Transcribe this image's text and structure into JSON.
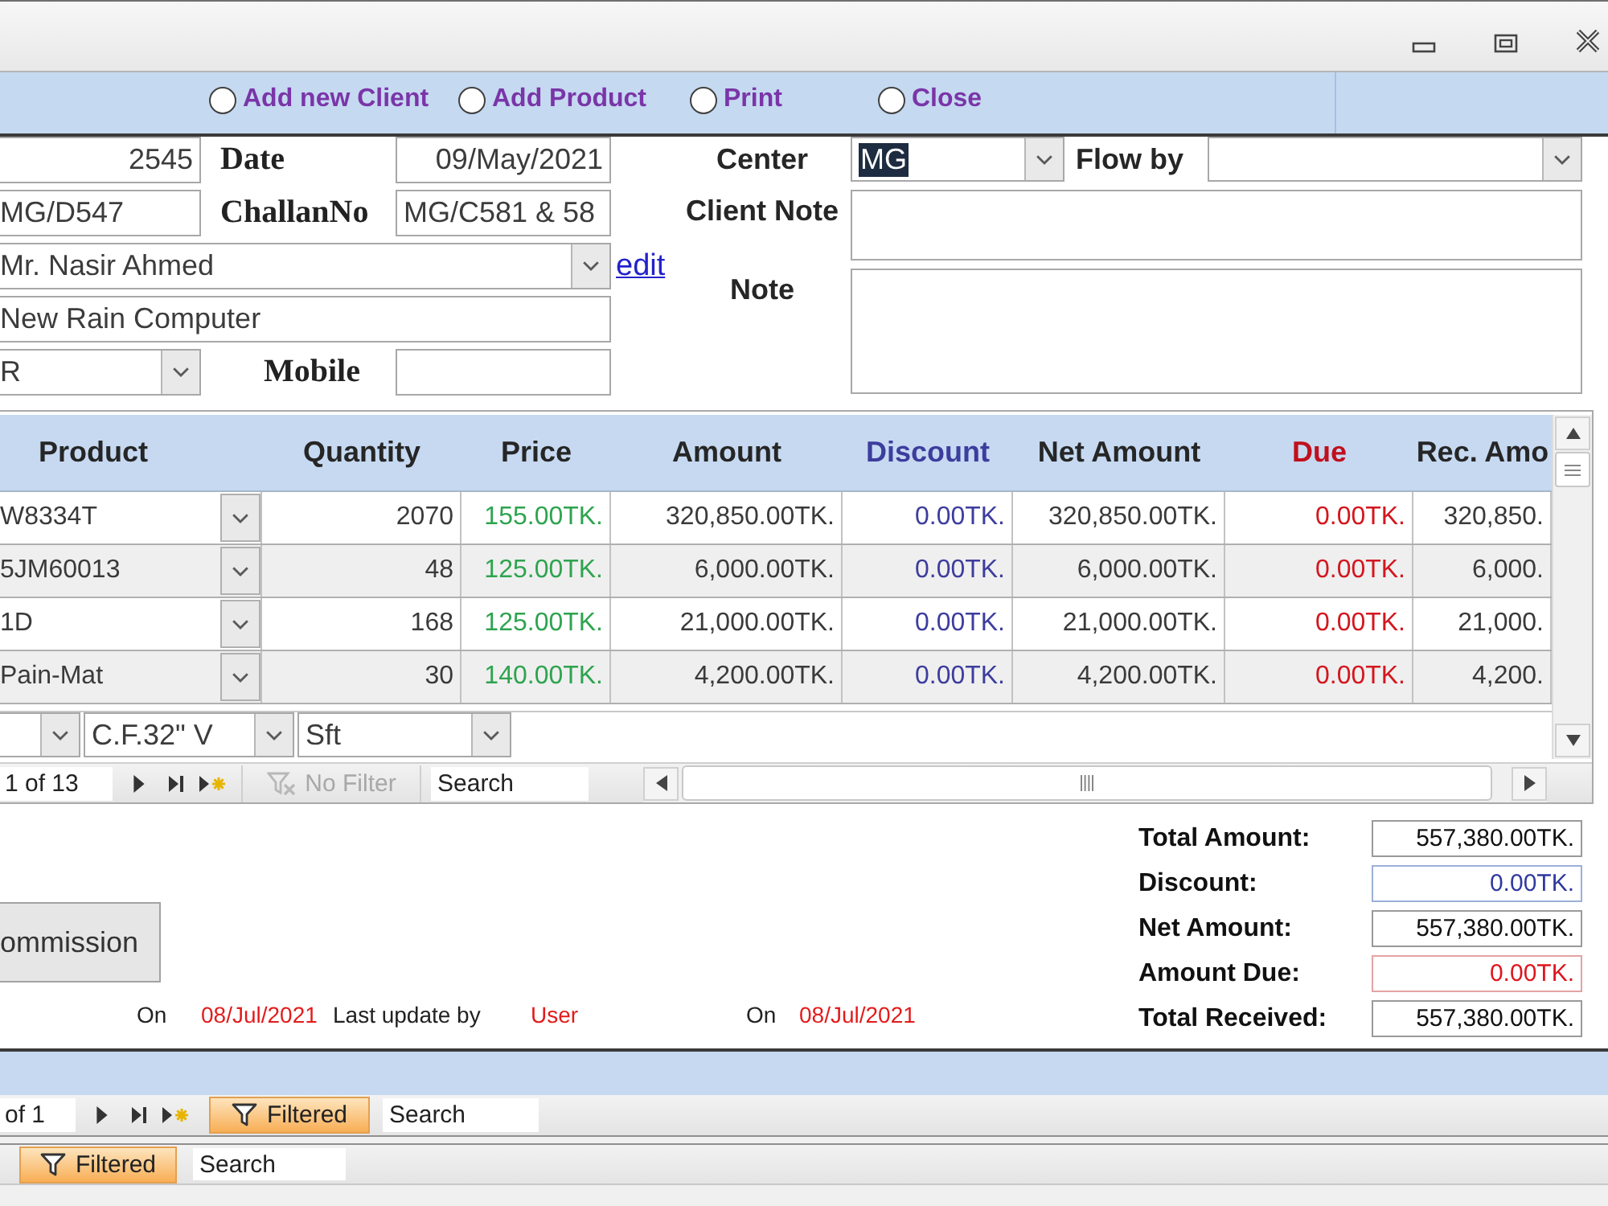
{
  "options": [
    {
      "label": "Add new Client",
      "selected": false
    },
    {
      "label": "Add Product",
      "selected": false
    },
    {
      "label": "Print",
      "selected": false
    },
    {
      "label": "Close",
      "selected": false
    }
  ],
  "form": {
    "field_1": {
      "value": "2545"
    },
    "date": {
      "label": "Date",
      "value": "09/May/2021"
    },
    "center": {
      "label": "Center",
      "value": "MG",
      "highlighted": true
    },
    "flow_by": {
      "label": "Flow by"
    },
    "field_2": {
      "value": "MG/D547"
    },
    "challan_no": {
      "label": "ChallanNo",
      "value": "MG/C581 & 58"
    },
    "client_note": {
      "label": "Client Note"
    },
    "field_3": {
      "value": "Mr. Nasir Ahmed"
    },
    "edit_link": "edit",
    "note": {
      "label": "Note"
    },
    "field_4": {
      "value": "New Rain Computer"
    },
    "field_5": {
      "value": "R"
    },
    "mobile": {
      "label": "Mobile"
    }
  },
  "grid": {
    "columns": [
      {
        "label": "Product",
        "kind": "combo"
      },
      {
        "label": "Quantity",
        "kind": "number"
      },
      {
        "label": "Price",
        "kind": "price"
      },
      {
        "label": "Amount",
        "kind": "number"
      },
      {
        "label": "Discount",
        "kind": "discount"
      },
      {
        "label": "Net Amount",
        "kind": "number"
      },
      {
        "label": "Due",
        "kind": "due"
      },
      {
        "label": "Rec. Amo",
        "kind": "number"
      }
    ],
    "rows": [
      [
        "W8334T",
        "2070",
        "155.00TK.",
        "320,850.00TK.",
        "0.00TK.",
        "320,850.00TK.",
        "0.00TK.",
        "320,850."
      ],
      [
        "5JM60013",
        "48",
        "125.00TK.",
        "6,000.00TK.",
        "0.00TK.",
        "6,000.00TK.",
        "0.00TK.",
        "6,000."
      ],
      [
        "1D",
        "168",
        "125.00TK.",
        "21,000.00TK.",
        "0.00TK.",
        "21,000.00TK.",
        "0.00TK.",
        "21,000."
      ],
      [
        "Pain-Mat",
        "30",
        "140.00TK.",
        "4,200.00TK.",
        "0.00TK.",
        "4,200.00TK.",
        "0.00TK.",
        "4,200."
      ]
    ],
    "new_row": [
      "C.F.32\" V",
      "Sft"
    ],
    "navigator": {
      "record": "1 of 13",
      "filter": {
        "label": "No Filter",
        "active": false
      },
      "search": {
        "placeholder": "Search"
      }
    }
  },
  "summary": {
    "commission_button": "ommission",
    "footer": [
      {
        "text": "On",
        "kind": "label"
      },
      {
        "text": "08/Jul/2021",
        "kind": "value"
      },
      {
        "text": "Last update by",
        "kind": "label"
      },
      {
        "text": "User",
        "kind": "value"
      },
      {
        "text": "On",
        "kind": "label"
      },
      {
        "text": "08/Jul/2021",
        "kind": "value"
      }
    ],
    "totals": [
      {
        "label": "Total Amount:",
        "value": "557,380.00TK.",
        "kind": "plain"
      },
      {
        "label": "Discount:",
        "value": "0.00TK.",
        "kind": "discount"
      },
      {
        "label": "Net Amount:",
        "value": "557,380.00TK.",
        "kind": "plain"
      },
      {
        "label": "Amount Due:",
        "value": "0.00TK.",
        "kind": "due"
      },
      {
        "label": "Total Received:",
        "value": "557,380.00TK.",
        "kind": "plain"
      }
    ]
  },
  "subform_navigator": {
    "record": "of 1",
    "filter": {
      "label": "Filtered",
      "active": true
    },
    "search": {
      "placeholder": "Search"
    }
  },
  "form_navigator": {
    "filter": {
      "label": "Filtered",
      "active": true
    },
    "search": {
      "placeholder": "Search"
    }
  }
}
